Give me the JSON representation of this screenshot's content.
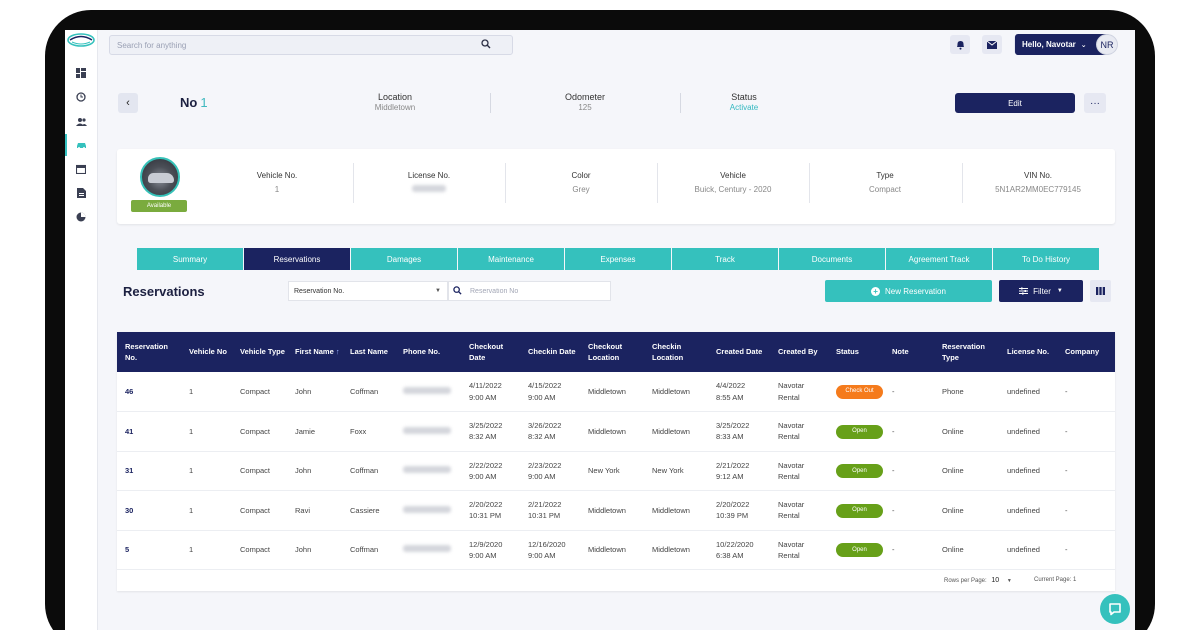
{
  "topbar": {
    "search_placeholder": "Search for anything",
    "greeting": "Hello, Navotar",
    "avatar_initials": "NR"
  },
  "header": {
    "title": "No",
    "title_number": "1",
    "location_label": "Location",
    "location_value": "Middletown",
    "odometer_label": "Odometer",
    "odometer_value": "125",
    "status_label": "Status",
    "status_value": "Activate",
    "edit_label": "Edit",
    "more_label": "···"
  },
  "vehicle": {
    "availability": "Available",
    "fields": [
      {
        "label": "Vehicle No.",
        "value": "1"
      },
      {
        "label": "License No.",
        "value": ""
      },
      {
        "label": "Color",
        "value": "Grey"
      },
      {
        "label": "Vehicle",
        "value": "Buick, Century - 2020"
      },
      {
        "label": "Type",
        "value": "Compact"
      },
      {
        "label": "VIN No.",
        "value": "5N1AR2MM0EC779145"
      }
    ]
  },
  "tabs": [
    "Summary",
    "Reservations",
    "Damages",
    "Maintenance",
    "Expenses",
    "Track",
    "Documents",
    "Agreement Track",
    "To Do History"
  ],
  "active_tab": "Reservations",
  "reservations": {
    "title": "Reservations",
    "filter_field": "Reservation No.",
    "search_placeholder": "Reservation No",
    "new_button": "New Reservation",
    "filter_button": "Filter",
    "columns": [
      "Reservation No.",
      "Vehicle No",
      "Vehicle Type",
      "First Name",
      "Last Name",
      "Phone No.",
      "Checkout Date",
      "Checkin Date",
      "Checkout Location",
      "Checkin Location",
      "Created Date",
      "Created By",
      "Status",
      "Note",
      "Reservation Type",
      "License No.",
      "Company"
    ],
    "rows": [
      {
        "id": "46",
        "vehicle": "1",
        "type": "Compact",
        "first": "John",
        "last": "Coffman",
        "checkout_date": "4/11/2022",
        "checkout_time": "9:00 AM",
        "checkin_date": "4/15/2022",
        "checkin_time": "9:00 AM",
        "checkout_loc": "Middletown",
        "checkin_loc": "Middletown",
        "created_date": "4/4/2022",
        "created_time": "8:55 AM",
        "created_by_1": "Navotar",
        "created_by_2": "Rental",
        "status": "Check Out",
        "note": "-",
        "res_type": "Phone",
        "license": "undefined",
        "company": "-"
      },
      {
        "id": "41",
        "vehicle": "1",
        "type": "Compact",
        "first": "Jamie",
        "last": "Foxx",
        "checkout_date": "3/25/2022",
        "checkout_time": "8:32 AM",
        "checkin_date": "3/26/2022",
        "checkin_time": "8:32 AM",
        "checkout_loc": "Middletown",
        "checkin_loc": "Middletown",
        "created_date": "3/25/2022",
        "created_time": "8:33 AM",
        "created_by_1": "Navotar",
        "created_by_2": "Rental",
        "status": "Open",
        "note": "-",
        "res_type": "Online",
        "license": "undefined",
        "company": "-"
      },
      {
        "id": "31",
        "vehicle": "1",
        "type": "Compact",
        "first": "John",
        "last": "Coffman",
        "checkout_date": "2/22/2022",
        "checkout_time": "9:00 AM",
        "checkin_date": "2/23/2022",
        "checkin_time": "9:00 AM",
        "checkout_loc": "New York",
        "checkin_loc": "New York",
        "created_date": "2/21/2022",
        "created_time": "9:12 AM",
        "created_by_1": "Navotar",
        "created_by_2": "Rental",
        "status": "Open",
        "note": "-",
        "res_type": "Online",
        "license": "undefined",
        "company": "-"
      },
      {
        "id": "30",
        "vehicle": "1",
        "type": "Compact",
        "first": "Ravi",
        "last": "Cassiere",
        "checkout_date": "2/20/2022",
        "checkout_time": "10:31 PM",
        "checkin_date": "2/21/2022",
        "checkin_time": "10:31 PM",
        "checkout_loc": "Middletown",
        "checkin_loc": "Middletown",
        "created_date": "2/20/2022",
        "created_time": "10:39 PM",
        "created_by_1": "Navotar",
        "created_by_2": "Rental",
        "status": "Open",
        "note": "-",
        "res_type": "Online",
        "license": "undefined",
        "company": "-"
      },
      {
        "id": "5",
        "vehicle": "1",
        "type": "Compact",
        "first": "John",
        "last": "Coffman",
        "checkout_date": "12/9/2020",
        "checkout_time": "9:00 AM",
        "checkin_date": "12/16/2020",
        "checkin_time": "9:00 AM",
        "checkout_loc": "Middletown",
        "checkin_loc": "Middletown",
        "created_date": "10/22/2020",
        "created_time": "6:38 AM",
        "created_by_1": "Navotar",
        "created_by_2": "Rental",
        "status": "Open",
        "note": "-",
        "res_type": "Online",
        "license": "undefined",
        "company": "-"
      }
    ],
    "footer": {
      "rows_per_page_label": "Rows per Page:",
      "rows_per_page_value": "10",
      "current_page": "Current Page: 1"
    }
  },
  "colors": {
    "navy": "#1b2360",
    "teal": "#35c1bd",
    "check_out": "#f57b1c",
    "open": "#67a019",
    "available": "#7aab3e"
  }
}
